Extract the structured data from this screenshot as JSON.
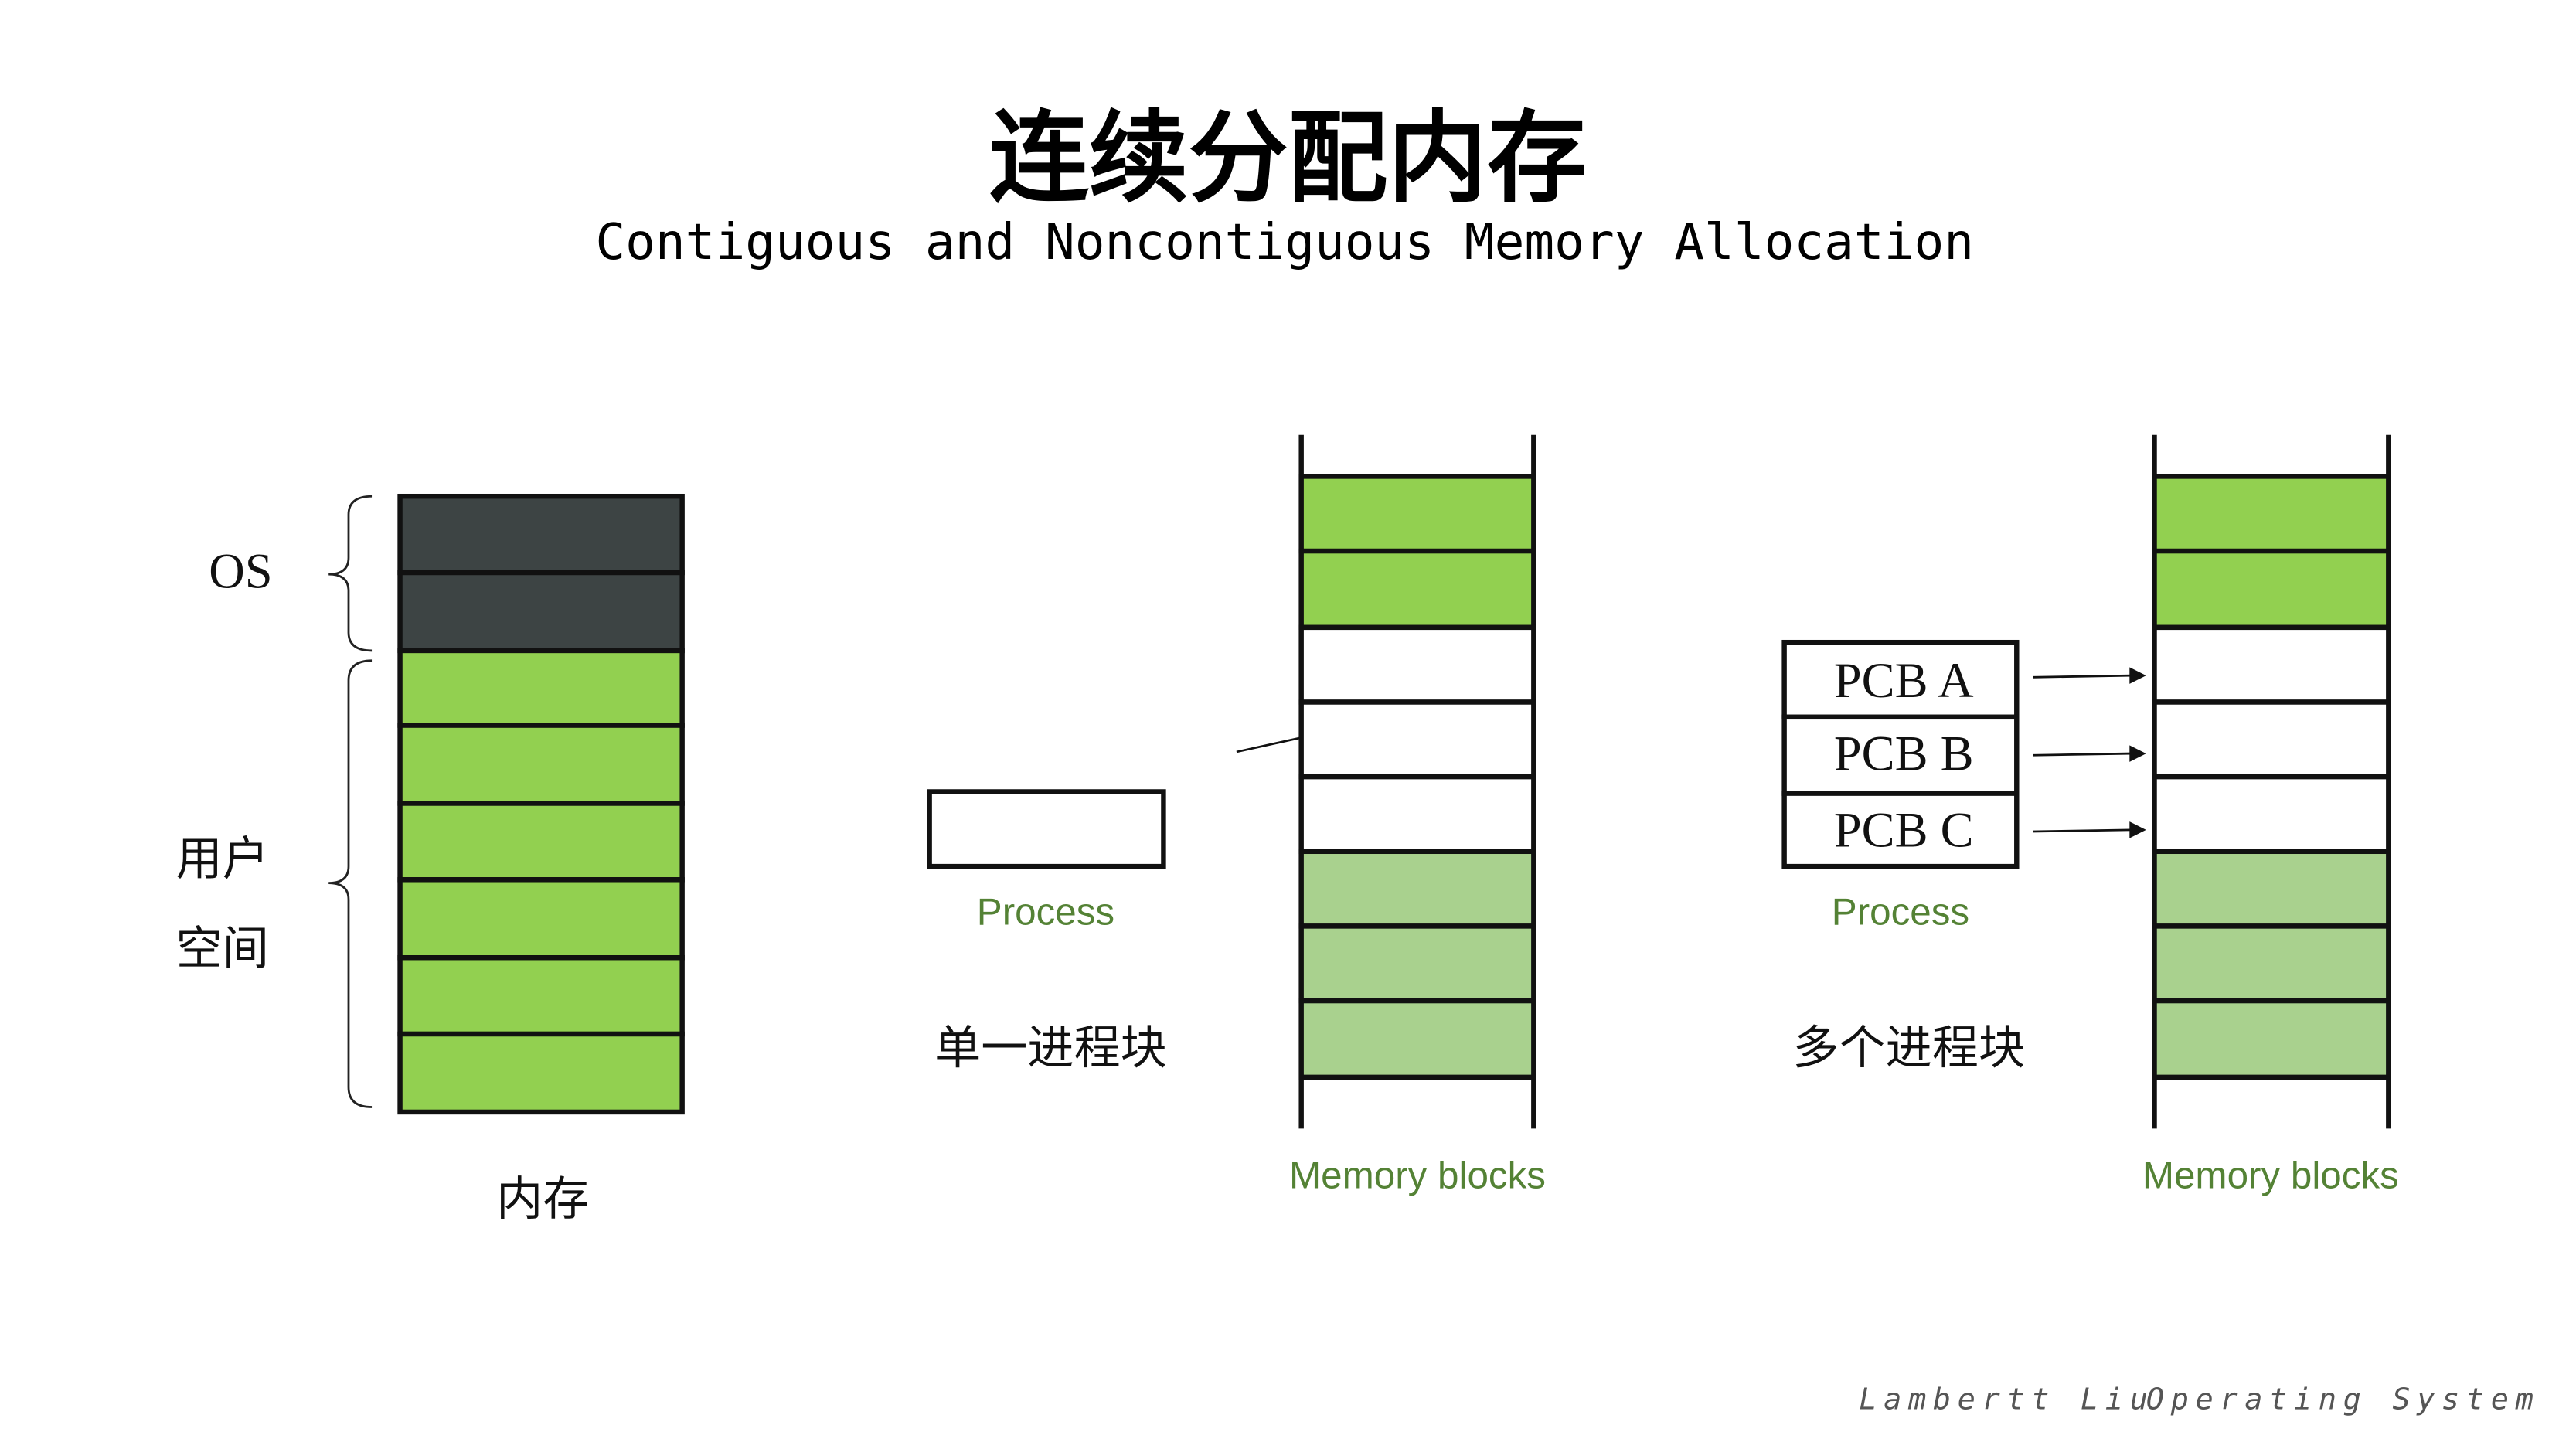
{
  "title": {
    "cn": "连续分配内存",
    "en": "Contiguous and Noncontiguous Memory Allocation"
  },
  "memory_diagram": {
    "os_label": "OS",
    "user_space_label_line1": "用户",
    "user_space_label_line2": "空间",
    "caption": "内存",
    "os_block_count": 2,
    "user_block_count": 6
  },
  "single_process": {
    "process_label": "Process",
    "caption": "单一进程块",
    "memory_label": "Memory blocks"
  },
  "multi_process": {
    "pcbs": [
      "PCB A",
      "PCB B",
      "PCB C"
    ],
    "process_label": "Process",
    "caption": "多个进程块",
    "memory_label": "Memory blocks"
  },
  "footer": {
    "author": "Lambertt Liu",
    "course": "Operating System"
  },
  "colors": {
    "os_block": "#3d4444",
    "used_block": "#92d050",
    "light_block": "#a9d18e",
    "free_block": "#ffffff",
    "label_green": "#548235"
  }
}
